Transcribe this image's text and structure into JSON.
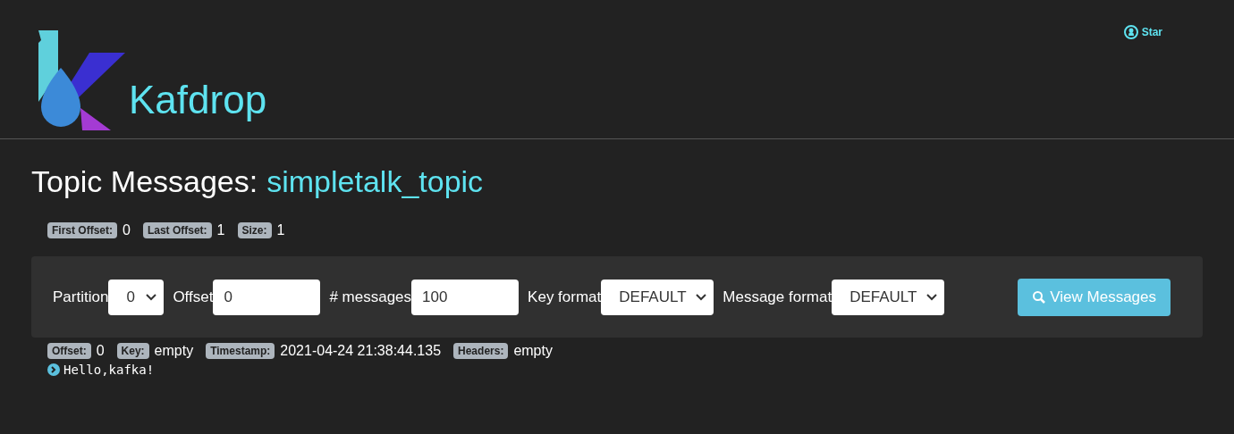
{
  "header": {
    "brand": "Kafdrop",
    "star_link": "Star"
  },
  "page_title": {
    "prefix": "Topic Messages:",
    "topic": "simpletalk_topic"
  },
  "stats": [
    {
      "label": "First Offset:",
      "value": "0"
    },
    {
      "label": "Last Offset:",
      "value": "1"
    },
    {
      "label": "Size:",
      "value": "1"
    }
  ],
  "filters": [
    {
      "kind": "select",
      "label": "Partition",
      "value": "0"
    },
    {
      "kind": "input",
      "label": "Offset",
      "value": "0"
    },
    {
      "kind": "input",
      "label": "# messages",
      "value": "100"
    },
    {
      "kind": "select",
      "label": "Key format",
      "value": "DEFAULT"
    },
    {
      "kind": "select",
      "label": "Message format",
      "value": "DEFAULT"
    }
  ],
  "view_button": "View Messages",
  "messages": [
    {
      "meta": [
        {
          "label": "Offset:",
          "value": "0"
        },
        {
          "label": "Key:",
          "value": "empty"
        },
        {
          "label": "Timestamp:",
          "value": "2021-04-24 21:38:44.135"
        },
        {
          "label": "Headers:",
          "value": "empty"
        }
      ],
      "body": "Hello,kafka!",
      "expanded": false
    }
  ]
}
